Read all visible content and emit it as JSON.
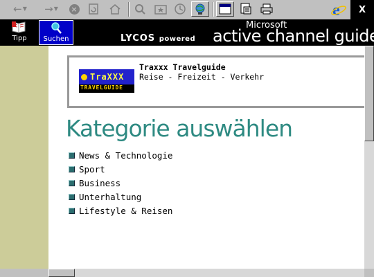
{
  "toolbar": {
    "buttons": [
      {
        "name": "back-button",
        "icon": "back-arrow-icon"
      },
      {
        "name": "forward-button",
        "icon": "forward-arrow-icon"
      },
      {
        "name": "stop-button",
        "icon": "stop-icon"
      },
      {
        "name": "refresh-button",
        "icon": "refresh-icon"
      },
      {
        "name": "home-button",
        "icon": "home-icon"
      },
      {
        "name": "search-button",
        "icon": "search-icon"
      },
      {
        "name": "favorites-button",
        "icon": "favorites-icon"
      },
      {
        "name": "history-button",
        "icon": "history-icon"
      },
      {
        "name": "channels-button",
        "icon": "channels-icon"
      },
      {
        "name": "fullscreen-button",
        "icon": "fullscreen-icon"
      },
      {
        "name": "mail-button",
        "icon": "mail-icon"
      },
      {
        "name": "print-button",
        "icon": "print-icon"
      }
    ],
    "close_label": "X"
  },
  "header": {
    "tipp_label": "Tipp",
    "suchen_label": "Suchen",
    "lycos_text": "LYCOS",
    "powered_text": "powered",
    "brand_top": "Microsoft",
    "brand_main": "active channel guide"
  },
  "channel": {
    "logo_name": "TraXXX",
    "logo_sub": "TRAVELGUIDE",
    "title": "Traxxx Travelguide",
    "description": "Reise - Freizeit - Verkehr"
  },
  "main": {
    "heading": "Kategorie auswählen",
    "categories": [
      {
        "label": "News & Technologie"
      },
      {
        "label": "Sport"
      },
      {
        "label": "Business"
      },
      {
        "label": "Unterhaltung"
      },
      {
        "label": "Lifestyle & Reisen"
      }
    ]
  },
  "colors": {
    "heading": "#2e8a82",
    "left_bar": "#cccc99",
    "active_button": "#0000c8",
    "bullet": "#2b6d6f"
  }
}
